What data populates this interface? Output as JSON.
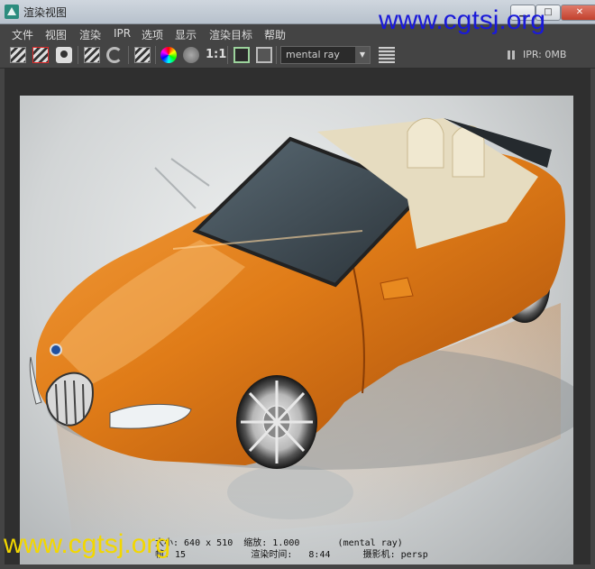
{
  "window": {
    "title": "渲染视图",
    "minimize_label": "▁",
    "maximize_label": "□",
    "close_label": "✕"
  },
  "watermarks": {
    "top": "www.cgtsj.org",
    "bottom": "www.cgtsj.org"
  },
  "menu": {
    "items": [
      "文件",
      "视图",
      "渲染",
      "IPR",
      "选项",
      "显示",
      "渲染目标",
      "帮助"
    ]
  },
  "toolbar": {
    "icons": [
      "render-clapper-icon",
      "region-render-icon",
      "snapshot-camera-icon",
      "keep-image-icon",
      "refresh-icon",
      "ipr-clapper-icon",
      "color-channel-icon",
      "gray-channel-icon",
      "ratio-icon",
      "frame-icon",
      "alpha-frame-icon",
      "render-layers-icon"
    ],
    "ratio_label": "1:1",
    "renderer": "mental ray",
    "ipr_status": "IPR: 0MB"
  },
  "render_info": {
    "line1": "大小: 640 x 510  缩放: 1.000       (mental ray)",
    "line2": "帧: 15            渲染时间:   8:44      摄影机: persp"
  },
  "colors": {
    "car_paint": "#e8841c",
    "background": "#d4d7d8",
    "interior": "#e6dcc0",
    "watermark_top": "#1a1ad8",
    "watermark_bottom": "#f2d700"
  }
}
